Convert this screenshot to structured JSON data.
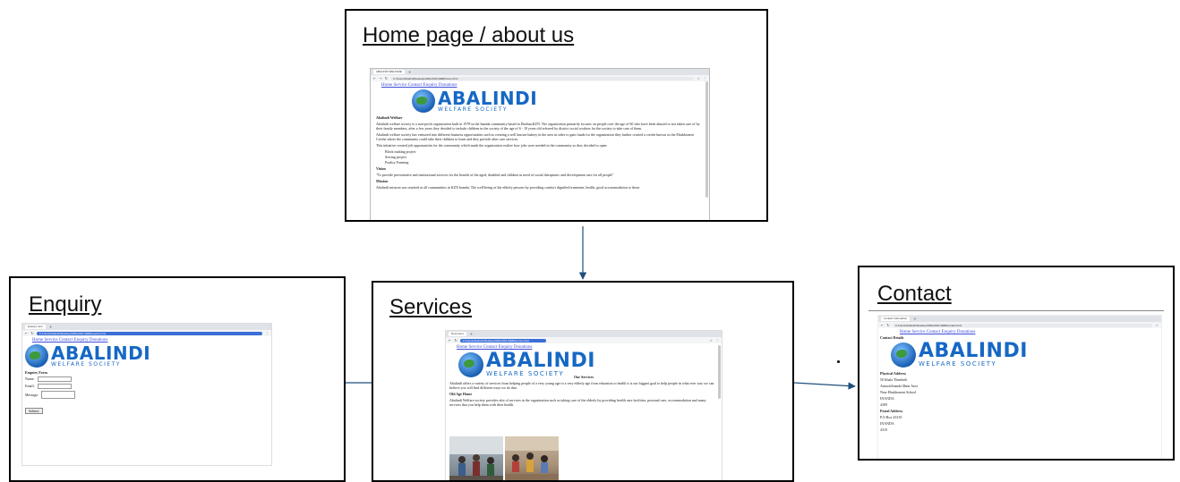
{
  "diagram": {
    "nodes": {
      "home": {
        "title": "Home page / about us",
        "screenshot": {
          "tab": "ABALINDI WELFARE",
          "address": "C:/Users/Abalindi/Desktop/ABALINDI-WEB/home.html",
          "nav": "Home Service Contact Enquiry Donations",
          "logo_main": "ABALINDI",
          "logo_sub": "WELFARE SOCIETY",
          "heading": "Abalindi Welfare",
          "para1": "Abalindi welfare society is a non-profit organization built in 1978 in the Inanda community based in Durban,KZN. The organization primarily focuses on people over the age of 60 who have been abused or not taken care of by their family members, after a few years they decided to include children in the society of the age of 6 - 18 years old referred by district social workers for the society to take care of them.",
          "para2": "Abalindi welfare society has ventured into different business opportunities such as creating a well known bakery in the area in order to gain funds for the organization they further created a creche known as the Ebukhoneni Creche where the community could take their children to learn and they provide after care services.",
          "para3": "This initiative created job opportunities for the community which made the organization realize how jobs were needed in the community so they decided to open:",
          "bullets": [
            "Block making project",
            "Sewing project",
            "Poultry Farming"
          ],
          "vision_heading": "Vision",
          "vision_text": "\"To provide preventative and institutional services for the benefit of the aged, disabled and children in need of social therapeutic and development care for all people\"",
          "mission_heading": "Mission",
          "mission_text": "Abalindi mission was reached at all communities in KZN Inanda. The well-being of the elderly persons by providing comfort dignified treatment, health, good accommodation to those"
        }
      },
      "enquiry": {
        "title": "Enquiry",
        "screenshot": {
          "tab": "Enquiry form",
          "address": "C:/Users/Abalindi/Desktop/ABALINDI-WEB/enquiry.html",
          "nav": "Home Service Contact Enquiry Donations",
          "logo_main": "ABALINDI",
          "logo_sub": "WELFARE SOCIETY",
          "form_heading": "Enquiry Form",
          "name_label": "Name:",
          "email_label": "Email:",
          "message_label": "Message:",
          "submit_label": "Submit"
        }
      },
      "services": {
        "title": "Services",
        "screenshot": {
          "tab": "Document",
          "address": "C:/Users/Abalindi/Desktop/ABALINDI-WEB/service.html",
          "nav": "Home Service Contact Enquiry Donations",
          "logo_main": "ABALINDI",
          "logo_sub": "WELFARE SOCIETY",
          "heading": "Our Services",
          "para1": "Abalindi offers a variety of services from helping people of a very young age to a very elderly age from education to health it is our biggest goal to help people in what ever way we can believe you will find different ways we do that.",
          "section_heading": "Old Age Home",
          "para2": "Abalindi Welfare society provides alot of services in the organization such as taking care of the elderly by providing health care facilities, personal care, accommodation and many services that you help them with their health."
        }
      },
      "contact": {
        "title": "Contact",
        "screenshot": {
          "tab": "Contact Information",
          "address": "C:/Users/Abalindi/Desktop/ABALINDI-WEB/contact.html",
          "nav": "Home Service Contact Enquiry Donations",
          "heading": "Contact Details",
          "logo_main": "ABALINDI",
          "logo_sub": "WELFARE SOCIETY",
          "physical_heading": "Physical Address",
          "physical_lines": [
            "50 Ithala Thembeli",
            "Amaoti/Inanda Main Area",
            "Near Ebukhoneni School",
            "INANDA",
            "4309"
          ],
          "postal_heading": "Postal Address",
          "postal_lines": [
            "P.O Box 43319",
            "INANDA",
            "4310"
          ]
        }
      }
    },
    "edges": [
      {
        "from": "home",
        "to": "services"
      },
      {
        "from": "enquiry",
        "to": "services"
      },
      {
        "from": "services",
        "to": "contact"
      }
    ],
    "colors": {
      "stroke": "#000000",
      "connector": "#1f4e79",
      "logo": "#1668c4",
      "link": "#3b4cd8"
    }
  }
}
